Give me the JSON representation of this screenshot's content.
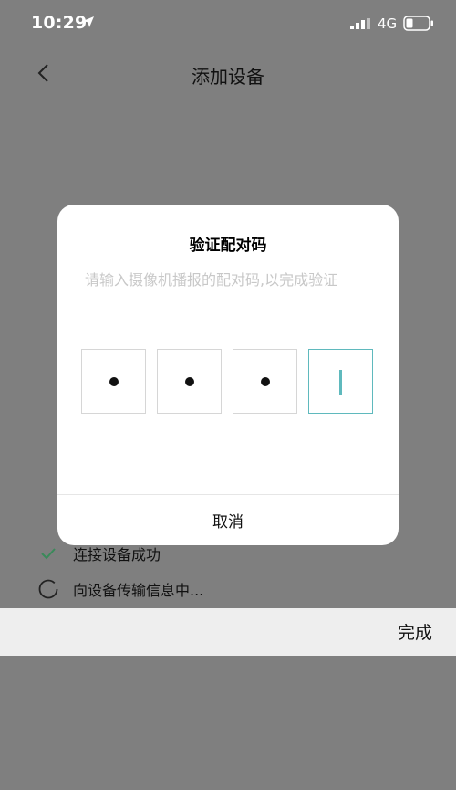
{
  "status_bar": {
    "time": "10:29",
    "network": "4G"
  },
  "nav": {
    "title": "添加设备"
  },
  "dialog": {
    "title": "验证配对码",
    "description": "请输入摄像机播报的配对码,以完成验证",
    "cancel_label": "取消",
    "code_slots": [
      "•",
      "•",
      "•",
      ""
    ]
  },
  "steps": [
    {
      "label": "连接设备成功",
      "state": "done"
    },
    {
      "label": "向设备传输信息中...",
      "state": "loading"
    }
  ],
  "footer": {
    "done_label": "完成"
  },
  "colors": {
    "accent": "#5fb9bd",
    "overlay": "#7f7f7f",
    "success": "#3a8a5a"
  }
}
